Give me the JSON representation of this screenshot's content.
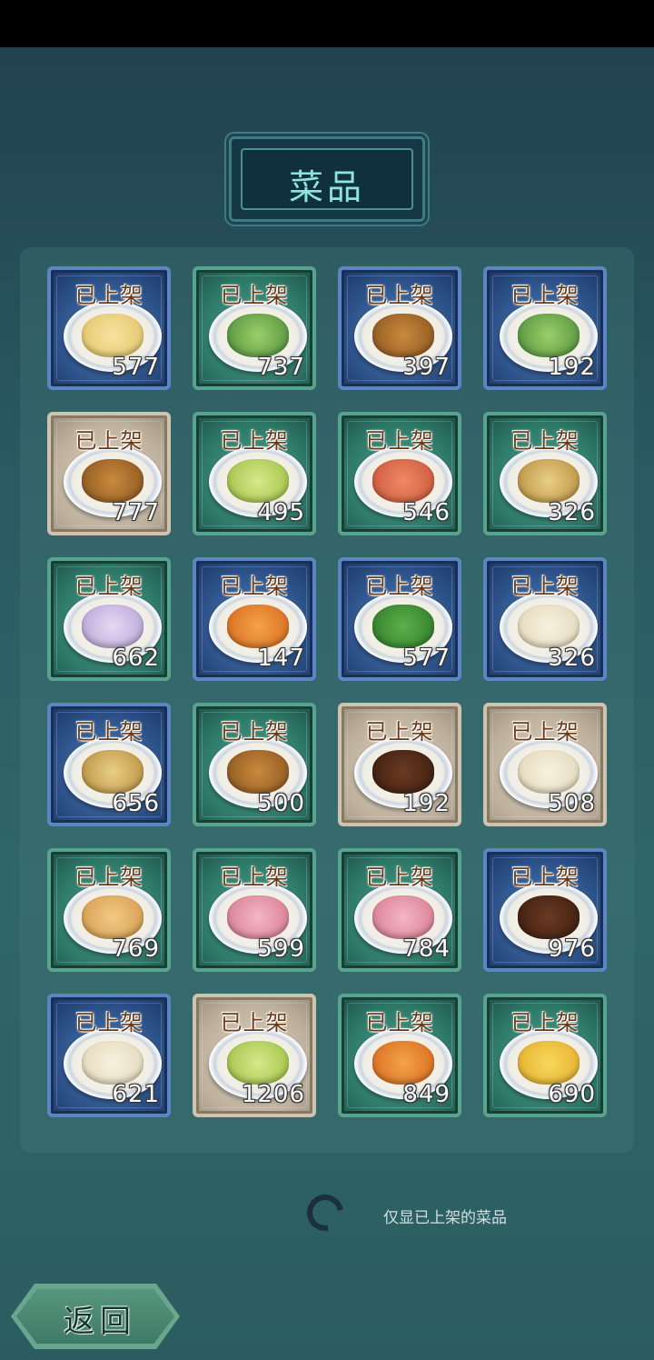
{
  "header": {
    "title": "菜品"
  },
  "dishes": [
    {
      "label": "已上架",
      "count": "577",
      "frame": "blue",
      "food": "yellow"
    },
    {
      "label": "已上架",
      "count": "737",
      "frame": "green",
      "food": "greenf"
    },
    {
      "label": "已上架",
      "count": "397",
      "frame": "blue",
      "food": "brown"
    },
    {
      "label": "已上架",
      "count": "192",
      "frame": "blue",
      "food": "greenf"
    },
    {
      "label": "已上架",
      "count": "777",
      "frame": "beige",
      "food": "brown"
    },
    {
      "label": "已上架",
      "count": "495",
      "frame": "green",
      "food": "tea"
    },
    {
      "label": "已上架",
      "count": "546",
      "frame": "green",
      "food": "red"
    },
    {
      "label": "已上架",
      "count": "326",
      "frame": "green",
      "food": "noodle"
    },
    {
      "label": "已上架",
      "count": "662",
      "frame": "green",
      "food": "purple"
    },
    {
      "label": "已上架",
      "count": "147",
      "frame": "blue",
      "food": "orange"
    },
    {
      "label": "已上架",
      "count": "577",
      "frame": "blue",
      "food": "peas"
    },
    {
      "label": "已上架",
      "count": "326",
      "frame": "blue",
      "food": "pale"
    },
    {
      "label": "已上架",
      "count": "656",
      "frame": "blue",
      "food": "noodle"
    },
    {
      "label": "已上架",
      "count": "500",
      "frame": "green",
      "food": "brown"
    },
    {
      "label": "已上架",
      "count": "192",
      "frame": "beige",
      "food": "dark"
    },
    {
      "label": "已上架",
      "count": "508",
      "frame": "beige",
      "food": "pale"
    },
    {
      "label": "已上架",
      "count": "769",
      "frame": "green",
      "food": "tan"
    },
    {
      "label": "已上架",
      "count": "599",
      "frame": "green",
      "food": "pink"
    },
    {
      "label": "已上架",
      "count": "784",
      "frame": "green",
      "food": "pink"
    },
    {
      "label": "已上架",
      "count": "976",
      "frame": "blue",
      "food": "dark"
    },
    {
      "label": "已上架",
      "count": "621",
      "frame": "blue",
      "food": "pale"
    },
    {
      "label": "已上架",
      "count": "1206",
      "frame": "beige",
      "food": "tea"
    },
    {
      "label": "已上架",
      "count": "849",
      "frame": "green",
      "food": "orange"
    },
    {
      "label": "已上架",
      "count": "690",
      "frame": "green",
      "food": "soup"
    }
  ],
  "filter": {
    "label": "仅显已上架的菜品",
    "icon": "loading-ring-icon"
  },
  "footer": {
    "back_label": "返回"
  }
}
